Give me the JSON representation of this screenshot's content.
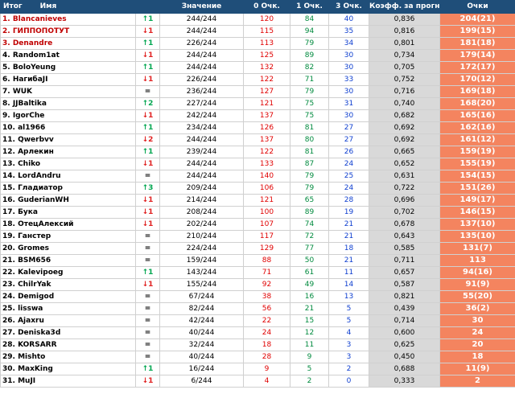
{
  "header": {
    "itog": "Итог",
    "name": "Имя",
    "znach": "Значение",
    "o0": "0 Очк.",
    "o1": "1 Очк.",
    "o3": "3 Очк.",
    "koef": "Коэфф. за прогноз",
    "points": "Очки"
  },
  "rows": [
    {
      "name": "1. Blancanieves",
      "red": true,
      "arrow": "↑",
      "change": "1",
      "dir": "up",
      "znach": "244/244",
      "o0": "120",
      "o1": "84",
      "o3": "40",
      "koef": "0,836",
      "points": "204(21)"
    },
    {
      "name": "2. ГИППОПОТУТ",
      "red": true,
      "arrow": "↓",
      "change": "1",
      "dir": "down",
      "znach": "244/244",
      "o0": "115",
      "o1": "94",
      "o3": "35",
      "koef": "0,816",
      "points": "199(15)"
    },
    {
      "name": "3. Denandre",
      "red": true,
      "arrow": "↑",
      "change": "1",
      "dir": "up",
      "znach": "226/244",
      "o0": "113",
      "o1": "79",
      "o3": "34",
      "koef": "0,801",
      "points": "181(18)"
    },
    {
      "name": "4. Random1at",
      "red": false,
      "arrow": "↓",
      "change": "1",
      "dir": "down",
      "znach": "244/244",
      "o0": "125",
      "o1": "89",
      "o3": "30",
      "koef": "0,734",
      "points": "179(14)"
    },
    {
      "name": "5. BoloYeung",
      "red": false,
      "arrow": "↑",
      "change": "1",
      "dir": "up",
      "znach": "244/244",
      "o0": "132",
      "o1": "82",
      "o3": "30",
      "koef": "0,705",
      "points": "172(17)"
    },
    {
      "name": "6. HaгибaJI",
      "red": false,
      "arrow": "↓",
      "change": "1",
      "dir": "down",
      "znach": "226/244",
      "o0": "122",
      "o1": "71",
      "o3": "33",
      "koef": "0,752",
      "points": "170(12)"
    },
    {
      "name": "7. WUK",
      "red": false,
      "arrow": "",
      "change": "=",
      "dir": "eq",
      "znach": "236/244",
      "o0": "127",
      "o1": "79",
      "o3": "30",
      "koef": "0,716",
      "points": "169(18)"
    },
    {
      "name": "8. JJBaltika",
      "red": false,
      "arrow": "↑",
      "change": "2",
      "dir": "up",
      "znach": "227/244",
      "o0": "121",
      "o1": "75",
      "o3": "31",
      "koef": "0,740",
      "points": "168(20)"
    },
    {
      "name": "9. IgorChe",
      "red": false,
      "arrow": "↓",
      "change": "1",
      "dir": "down",
      "znach": "242/244",
      "o0": "137",
      "o1": "75",
      "o3": "30",
      "koef": "0,682",
      "points": "165(16)"
    },
    {
      "name": "10. al1966",
      "red": false,
      "arrow": "↑",
      "change": "1",
      "dir": "up",
      "znach": "234/244",
      "o0": "126",
      "o1": "81",
      "o3": "27",
      "koef": "0,692",
      "points": "162(16)"
    },
    {
      "name": "11. Qwerbvv",
      "red": false,
      "arrow": "↓",
      "change": "2",
      "dir": "down",
      "znach": "244/244",
      "o0": "137",
      "o1": "80",
      "o3": "27",
      "koef": "0,692",
      "points": "161(12)"
    },
    {
      "name": "12. Арлекин",
      "red": false,
      "arrow": "↑",
      "change": "1",
      "dir": "up",
      "znach": "239/244",
      "o0": "122",
      "o1": "81",
      "o3": "26",
      "koef": "0,665",
      "points": "159(19)"
    },
    {
      "name": "13. Chiko",
      "red": false,
      "arrow": "↓",
      "change": "1",
      "dir": "down",
      "znach": "244/244",
      "o0": "133",
      "o1": "87",
      "o3": "24",
      "koef": "0,652",
      "points": "155(19)"
    },
    {
      "name": "14. LordAndru",
      "red": false,
      "arrow": "",
      "change": "=",
      "dir": "eq",
      "znach": "244/244",
      "o0": "140",
      "o1": "79",
      "o3": "25",
      "koef": "0,631",
      "points": "154(15)"
    },
    {
      "name": "15. Гладиатор",
      "red": false,
      "arrow": "↑",
      "change": "3",
      "dir": "up",
      "znach": "209/244",
      "o0": "106",
      "o1": "79",
      "o3": "24",
      "koef": "0,722",
      "points": "151(26)"
    },
    {
      "name": "16. GuderianWH",
      "red": false,
      "arrow": "↓",
      "change": "1",
      "dir": "down",
      "znach": "214/244",
      "o0": "121",
      "o1": "65",
      "o3": "28",
      "koef": "0,696",
      "points": "149(17)"
    },
    {
      "name": "17. Бука",
      "red": false,
      "arrow": "↓",
      "change": "1",
      "dir": "down",
      "znach": "208/244",
      "o0": "100",
      "o1": "89",
      "o3": "19",
      "koef": "0,702",
      "points": "146(15)"
    },
    {
      "name": "18. ОтецАлексий",
      "red": false,
      "arrow": "↓",
      "change": "1",
      "dir": "down",
      "znach": "202/244",
      "o0": "107",
      "o1": "74",
      "o3": "21",
      "koef": "0,678",
      "points": "137(10)"
    },
    {
      "name": "19. Ганстер",
      "red": false,
      "arrow": "",
      "change": "=",
      "dir": "eq",
      "znach": "210/244",
      "o0": "117",
      "o1": "72",
      "o3": "21",
      "koef": "0,643",
      "points": "135(10)"
    },
    {
      "name": "20. Gromes",
      "red": false,
      "arrow": "",
      "change": "=",
      "dir": "eq",
      "znach": "224/244",
      "o0": "129",
      "o1": "77",
      "o3": "18",
      "koef": "0,585",
      "points": "131(7)"
    },
    {
      "name": "21. BSM656",
      "red": false,
      "arrow": "",
      "change": "=",
      "dir": "eq",
      "znach": "159/244",
      "o0": "88",
      "o1": "50",
      "o3": "21",
      "koef": "0,711",
      "points": "113"
    },
    {
      "name": "22. Kalevipoeg",
      "red": false,
      "arrow": "↑",
      "change": "1",
      "dir": "up",
      "znach": "143/244",
      "o0": "71",
      "o1": "61",
      "o3": "11",
      "koef": "0,657",
      "points": "94(16)"
    },
    {
      "name": "23. ChilrYak",
      "red": false,
      "arrow": "↓",
      "change": "1",
      "dir": "down",
      "znach": "155/244",
      "o0": "92",
      "o1": "49",
      "o3": "14",
      "koef": "0,587",
      "points": "91(9)"
    },
    {
      "name": "24. Demigod",
      "red": false,
      "arrow": "",
      "change": "=",
      "dir": "eq",
      "znach": "67/244",
      "o0": "38",
      "o1": "16",
      "o3": "13",
      "koef": "0,821",
      "points": "55(20)"
    },
    {
      "name": "25. lisswa",
      "red": false,
      "arrow": "",
      "change": "=",
      "dir": "eq",
      "znach": "82/244",
      "o0": "56",
      "o1": "21",
      "o3": "5",
      "koef": "0,439",
      "points": "36(2)"
    },
    {
      "name": "26. Ajaxru",
      "red": false,
      "arrow": "",
      "change": "=",
      "dir": "eq",
      "znach": "42/244",
      "o0": "22",
      "o1": "15",
      "o3": "5",
      "koef": "0,714",
      "points": "30"
    },
    {
      "name": "27. Deniska3d",
      "red": false,
      "arrow": "",
      "change": "=",
      "dir": "eq",
      "znach": "40/244",
      "o0": "24",
      "o1": "12",
      "o3": "4",
      "koef": "0,600",
      "points": "24"
    },
    {
      "name": "28. KORSARR",
      "red": false,
      "arrow": "",
      "change": "=",
      "dir": "eq",
      "znach": "32/244",
      "o0": "18",
      "o1": "11",
      "o3": "3",
      "koef": "0,625",
      "points": "20"
    },
    {
      "name": "29. Mishto",
      "red": false,
      "arrow": "",
      "change": "=",
      "dir": "eq",
      "znach": "40/244",
      "o0": "28",
      "o1": "9",
      "o3": "3",
      "koef": "0,450",
      "points": "18"
    },
    {
      "name": "30. MaxKing",
      "red": false,
      "arrow": "↑",
      "change": "1",
      "dir": "up",
      "znach": "16/244",
      "o0": "9",
      "o1": "5",
      "o3": "2",
      "koef": "0,688",
      "points": "11(9)"
    },
    {
      "name": "31. MuJI",
      "red": false,
      "arrow": "↓",
      "change": "1",
      "dir": "down",
      "znach": "6/244",
      "o0": "4",
      "o1": "2",
      "o3": "0",
      "koef": "0,333",
      "points": "2"
    }
  ]
}
